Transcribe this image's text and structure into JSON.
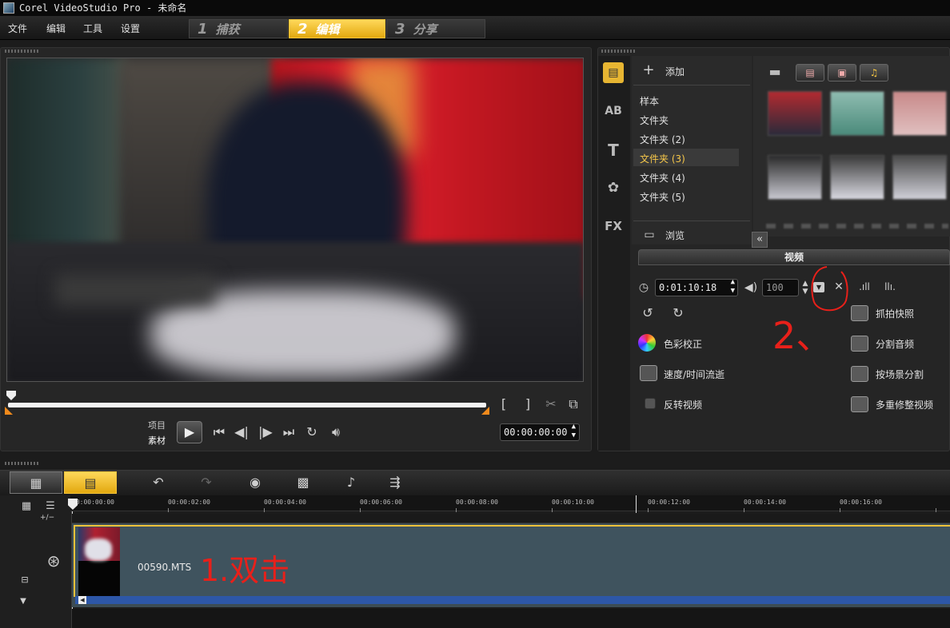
{
  "window": {
    "title": "Corel VideoStudio Pro - 未命名"
  },
  "menu": {
    "items": [
      "文件",
      "编辑",
      "工具",
      "设置"
    ]
  },
  "steps": [
    {
      "num": "1",
      "label": "捕获"
    },
    {
      "num": "2",
      "label": "编辑"
    },
    {
      "num": "3",
      "label": "分享"
    }
  ],
  "preview": {
    "mode_project": "项目",
    "mode_clip": "素材",
    "timecode": "00:00:00:00",
    "mark_in": "[",
    "mark_out": "]"
  },
  "library": {
    "add_label": "添加",
    "folders": [
      "样本",
      "文件夹",
      "文件夹 (2)",
      "文件夹 (3)",
      "文件夹 (4)",
      "文件夹 (5)"
    ],
    "selected_folder": "文件夹 (3)",
    "browse_label": "浏览",
    "side_icons": [
      "media-icon",
      "transition-icon",
      "title-icon",
      "graphic-icon",
      "filter-icon"
    ]
  },
  "options": {
    "tab_label": "视频",
    "duration": "0:01:10:18",
    "volume": "100",
    "color_correction": "色彩校正",
    "speed_time_lapse": "速度/时间流逝",
    "reverse_video": "反转视频",
    "snapshot": "抓拍快照",
    "split_audio": "分割音频",
    "split_by_scene": "按场景分割",
    "multi_trim": "多重修整视频",
    "annotation_step2": "2、"
  },
  "timeline": {
    "ruler_labels": [
      "00:00:00:00",
      "00:00:02:00",
      "00:00:04:00",
      "00:00:06:00",
      "00:00:08:00",
      "00:00:10:00",
      "00:00:12:00",
      "00:00:14:00",
      "00:00:16:00"
    ],
    "zoom_label": "+/−",
    "clip_name": "00590.MTS",
    "annotation_step1": "1.双击"
  },
  "colors": {
    "accent": "#f2c23a",
    "annotation": "#e8201a",
    "audio": "#2d57a8"
  }
}
